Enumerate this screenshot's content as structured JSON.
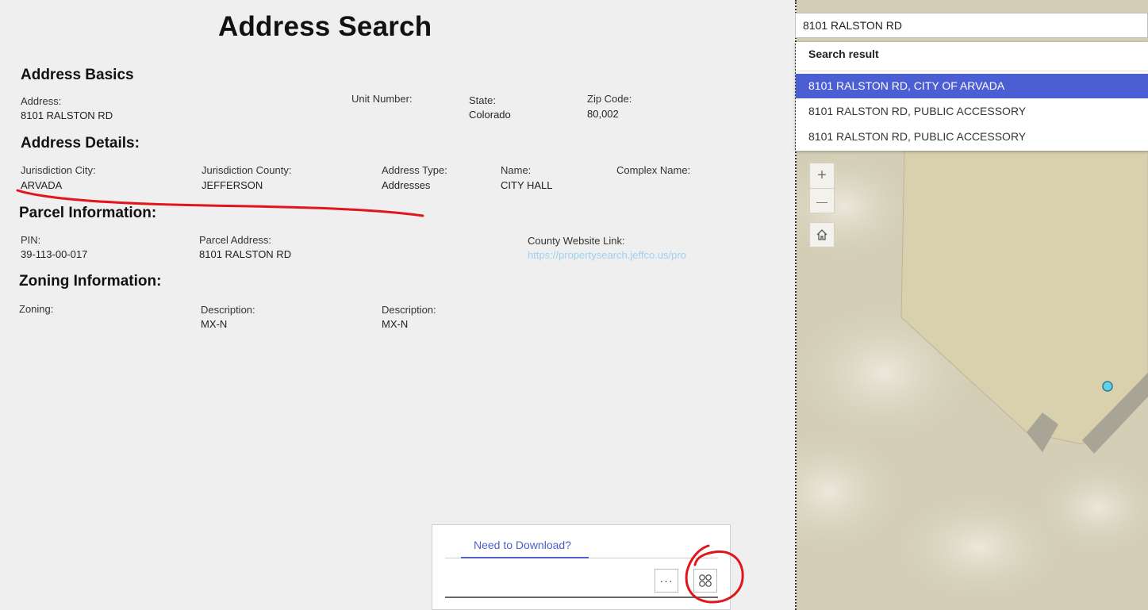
{
  "page_title": "Address Search",
  "sections": {
    "basics": {
      "title": "Address Basics",
      "address_label": "Address:",
      "address_value": "8101 RALSTON RD",
      "unit_label": "Unit Number:",
      "state_label": "State:",
      "state_value": "Colorado",
      "zip_label": "Zip Code:",
      "zip_value": "80,002"
    },
    "details": {
      "title": "Address Details:",
      "city_label": "Jurisdiction City:",
      "city_value": "ARVADA",
      "county_label": "Jurisdiction County:",
      "county_value": "JEFFERSON",
      "type_label": "Address Type:",
      "type_value": "Addresses",
      "name_label": "Name:",
      "name_value": "CITY HALL",
      "complex_label": "Complex Name:"
    },
    "parcel": {
      "title": "Parcel Information:",
      "pin_label": "PIN:",
      "pin_value": "39-113-00-017",
      "paddr_label": "Parcel Address:",
      "paddr_value": "8101 RALSTON RD",
      "link_label": "County Website Link:",
      "link_value": "https://propertysearch.jeffco.us/pro"
    },
    "zoning": {
      "title": "Zoning Information:",
      "zoning_label": "Zoning:",
      "desc1_label": "Description:",
      "desc1_value": "MX-N",
      "desc2_label": "Description:",
      "desc2_value": "MX-N"
    }
  },
  "search": {
    "value": "8101 RALSTON RD",
    "results_header": "Search result",
    "results": [
      "8101 RALSTON RD, CITY OF ARVADA",
      "8101 RALSTON RD, PUBLIC ACCESSORY",
      "8101 RALSTON RD, PUBLIC ACCESSORY"
    ]
  },
  "map_controls": {
    "zoom_in": "+",
    "zoom_out": "—"
  },
  "download_panel": {
    "tab_label": "Need to Download?",
    "more_label": "···"
  },
  "colors": {
    "accent": "#4c5ed4",
    "annotation": "#e0161b",
    "link": "#9fd0f3"
  },
  "icons": [
    "plus-icon",
    "minus-icon",
    "home-icon",
    "more-icon",
    "grid-icon"
  ]
}
